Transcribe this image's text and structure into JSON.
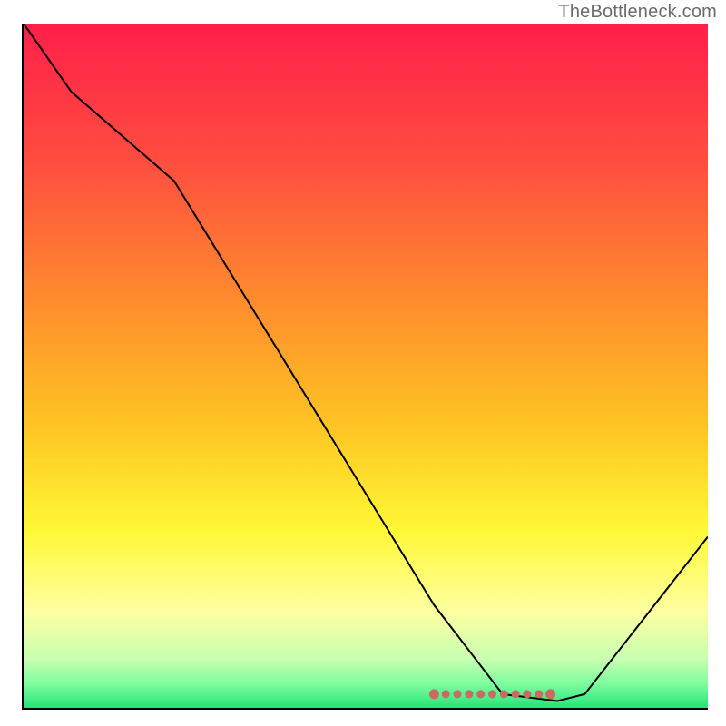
{
  "watermark": "TheBottleneck.com",
  "chart_data": {
    "type": "line",
    "title": "",
    "xlabel": "",
    "ylabel": "",
    "xlim": [
      0,
      100
    ],
    "ylim": [
      0,
      100
    ],
    "grid": false,
    "series": [
      {
        "name": "curve",
        "x": [
          0,
          7,
          22,
          60,
          70,
          78,
          82,
          100
        ],
        "y": [
          100,
          90,
          77,
          15,
          2,
          1,
          2,
          25
        ],
        "color": "#000000"
      }
    ],
    "marker_band": {
      "x_start": 60,
      "x_end": 77,
      "y": 2,
      "color": "#cc6960"
    },
    "background_gradient": {
      "stops": [
        {
          "offset": 0.0,
          "color": "#ff1f4a"
        },
        {
          "offset": 0.2,
          "color": "#ff4d3f"
        },
        {
          "offset": 0.4,
          "color": "#ff8a2e"
        },
        {
          "offset": 0.58,
          "color": "#ffc223"
        },
        {
          "offset": 0.74,
          "color": "#fff835"
        },
        {
          "offset": 0.86,
          "color": "#fdffa1"
        },
        {
          "offset": 0.93,
          "color": "#c6ffb0"
        },
        {
          "offset": 0.965,
          "color": "#7dfd9e"
        },
        {
          "offset": 1.0,
          "color": "#24e479"
        }
      ]
    }
  }
}
